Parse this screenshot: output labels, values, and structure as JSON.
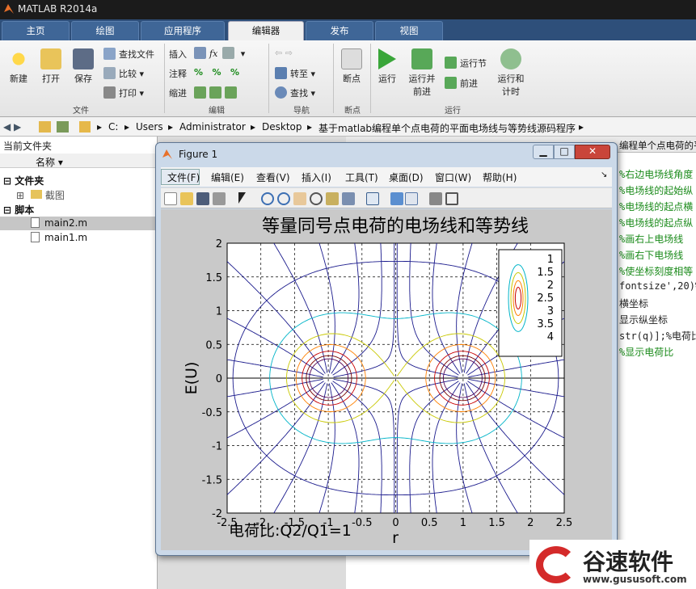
{
  "app": {
    "title": "MATLAB R2014a"
  },
  "tabs": [
    "主页",
    "绘图",
    "应用程序",
    "编辑器",
    "发布",
    "视图"
  ],
  "ribbon": {
    "new": "新建",
    "open": "打开",
    "save": "保存",
    "find_file": "查找文件",
    "compare": "比较",
    "print": "打印",
    "insert": "插入",
    "comment": "注释",
    "indent": "缩进",
    "goto": "转至",
    "find": "查找",
    "breakpoint": "断点",
    "run": "运行",
    "run_advance": "运行并\n前进",
    "run_section": "运行节",
    "advance": "前进",
    "run_time": "运行和\n计时",
    "groups": [
      "文件",
      "编辑",
      "导航",
      "断点",
      "运行"
    ]
  },
  "address": {
    "path": [
      "C:",
      "Users",
      "Administrator",
      "Desktop",
      "基于matlab编程单个点电荷的平面电场线与等势线源码程序"
    ]
  },
  "left_pane": {
    "title": "当前文件夹",
    "col_name": "名称",
    "folder_section": "文件夹",
    "folder_item": "截图",
    "script_section": "脚本",
    "files": [
      "main2.m",
      "main1.m"
    ]
  },
  "editor": {
    "tab_fragment": "编程单个点电荷的平",
    "lines": [
      "%右边电场线角度",
      "%电场线的起始纵",
      "%电场线的起点横",
      "%电场线的起点纵",
      "%画右上电场线",
      "%画右下电场线",
      "%使坐标刻度相等",
      "fontsize',20)%",
      "横坐标",
      "显示纵坐标",
      "str(q)];%电荷比",
      "%显示电荷比"
    ]
  },
  "figure": {
    "title": "Figure 1",
    "menu": [
      "文件(F)",
      "编辑(E)",
      "查看(V)",
      "插入(I)",
      "工具(T)",
      "桌面(D)",
      "窗口(W)",
      "帮助(H)"
    ]
  },
  "chart_data": {
    "type": "contour",
    "title": "等量同号点电荷的电场线和等势线",
    "xlabel": "r",
    "ylabel": "E(U)",
    "xlim": [
      -2.5,
      2.5
    ],
    "ylim": [
      -2,
      2
    ],
    "x_ticks": [
      -2.5,
      -2,
      -1.5,
      -1,
      -0.5,
      0,
      0.5,
      1,
      1.5,
      2,
      2.5
    ],
    "y_ticks": [
      -2,
      -1.5,
      -1,
      -0.5,
      0,
      0.5,
      1,
      1.5,
      2
    ],
    "charges": [
      {
        "x": -1,
        "y": 0
      },
      {
        "x": 1,
        "y": 0
      }
    ],
    "grid": true,
    "legend_position": "top-right",
    "legend": [
      "1",
      "1.5",
      "2",
      "2.5",
      "3",
      "3.5",
      "4"
    ],
    "annotation": "电荷比:Q2/Q1=1",
    "colors": [
      "#1a1a8c",
      "#00b4c8",
      "#c8c800",
      "#ff8000",
      "#c80000",
      "#780000",
      "#500050"
    ]
  },
  "watermark": {
    "brand": "谷速软件",
    "url": "www.gususoft.com"
  }
}
